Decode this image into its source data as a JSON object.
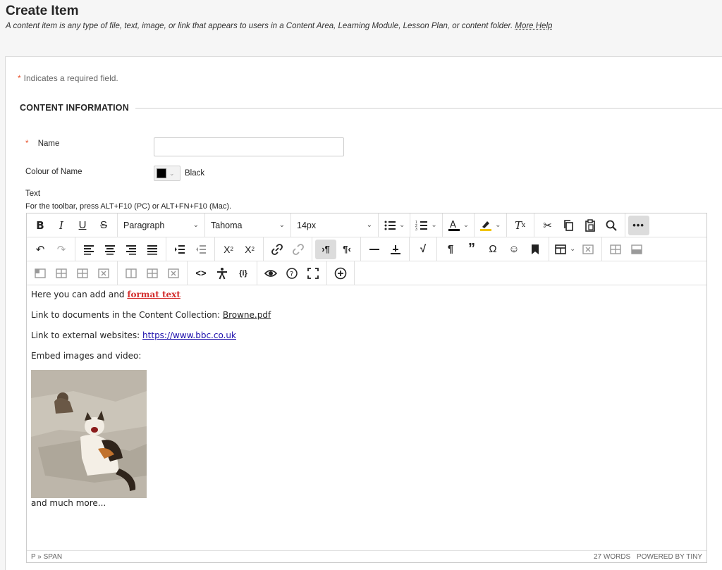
{
  "header": {
    "title": "Create Item",
    "subtitle": "A content item is any type of file, text, image, or link that appears to users in a Content Area, Learning Module, Lesson Plan, or content folder.",
    "more_help": "More Help"
  },
  "form": {
    "required_note": "Indicates a required field.",
    "required_star": "*",
    "section_title": "CONTENT INFORMATION",
    "name_label": "Name",
    "name_value": "",
    "colour_label": "Colour of Name",
    "colour_value": "Black",
    "colour_hex": "#000000",
    "text_label": "Text",
    "toolbar_hint": "For the toolbar, press ALT+F10 (PC) or ALT+FN+F10 (Mac)."
  },
  "toolbar": {
    "block_format": "Paragraph",
    "font_family": "Tahoma",
    "font_size": "14px",
    "row1": [
      "bold-icon",
      "italic-icon",
      "underline-icon",
      "strikethrough-icon",
      "bullet-list-icon",
      "numbered-list-icon",
      "text-color-icon",
      "highlight-icon",
      "clear-format-icon",
      "cut-icon",
      "copy-icon",
      "paste-icon",
      "find-icon",
      "more-icon"
    ],
    "row2": [
      "undo-icon",
      "redo-icon",
      "align-left-icon",
      "align-center-icon",
      "align-right-icon",
      "justify-icon",
      "indent-icon",
      "outdent-icon",
      "superscript-icon",
      "subscript-icon",
      "link-icon",
      "unlink-icon",
      "ltr-icon",
      "rtl-icon",
      "horizontal-line-icon",
      "anchor-icon",
      "math-icon",
      "paragraph-mark-icon",
      "quote-icon",
      "omega-icon",
      "emoji-icon",
      "bookmark-icon",
      "table-icon",
      "delete-table-icon",
      "row-before-icon",
      "row-after-icon"
    ],
    "row3": [
      "insert-col-before-icon",
      "insert-col-after-icon",
      "delete-col-icon",
      "delete-row-icon",
      "split-cell-icon",
      "merge-cell-icon",
      "cell-props-icon",
      "code-icon",
      "accessibility-icon",
      "mashup-icon",
      "preview-icon",
      "help-icon",
      "fullscreen-icon",
      "add-content-icon"
    ]
  },
  "editor": {
    "line1_text": "Here you can add and ",
    "line1_bold": "format text",
    "line2_text": "Link to documents in the Content Collection: ",
    "line2_link": "Browne.pdf",
    "line3_text": "Link to external websites: ",
    "line3_link": "https://www.bbc.co.uk",
    "line4_text": "Embed images and video:",
    "line5_text": "and much more...",
    "path": "P » SPAN",
    "word_count": "27 WORDS",
    "powered_by": "POWERED BY TINY"
  }
}
